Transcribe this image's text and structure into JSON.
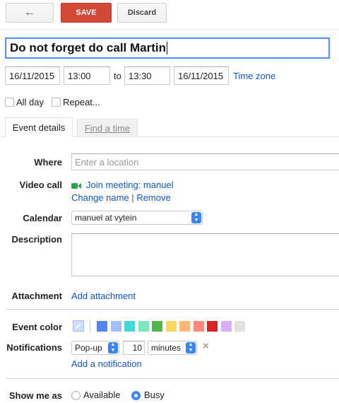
{
  "toolbar": {
    "back_label": "←",
    "save_label": "SAVE",
    "discard_label": "Discard"
  },
  "event": {
    "title": "Do not forget do call Martin",
    "start_date": "16/11/2015",
    "start_time": "13:00",
    "to_label": "to",
    "end_time": "13:30",
    "end_date": "16/11/2015",
    "timezone_label": "Time zone",
    "all_day_label": "All day",
    "repeat_label": "Repeat..."
  },
  "tabs": [
    {
      "label": "Event details"
    },
    {
      "label": "Find a time"
    }
  ],
  "details": {
    "where_label": "Where",
    "where_placeholder": "Enter a location",
    "video_label": "Video call",
    "video_join": "Join meeting: manuel",
    "video_change": "Change name",
    "video_sep": "|",
    "video_remove": "Remove",
    "calendar_label": "Calendar",
    "calendar_value": "manuel at vytein",
    "description_label": "Description",
    "attachment_label": "Attachment",
    "attachment_link": "Add attachment",
    "color_label": "Event color",
    "colors": [
      "#a4bdfc",
      "#5484ed",
      "#a4bdfc",
      "#46d6db",
      "#7ae7bf",
      "#51b749",
      "#fbd75b",
      "#ffb878",
      "#ff887c",
      "#dc2127",
      "#dbadff",
      "#e1e1e1"
    ],
    "notifications_label": "Notifications",
    "notification_type": "Pop-up",
    "notification_value": "10",
    "notification_unit": "minutes",
    "remove_icon": "×",
    "add_notification": "Add a notification",
    "show_as_label": "Show me as",
    "available_label": "Available",
    "busy_label": "Busy"
  }
}
